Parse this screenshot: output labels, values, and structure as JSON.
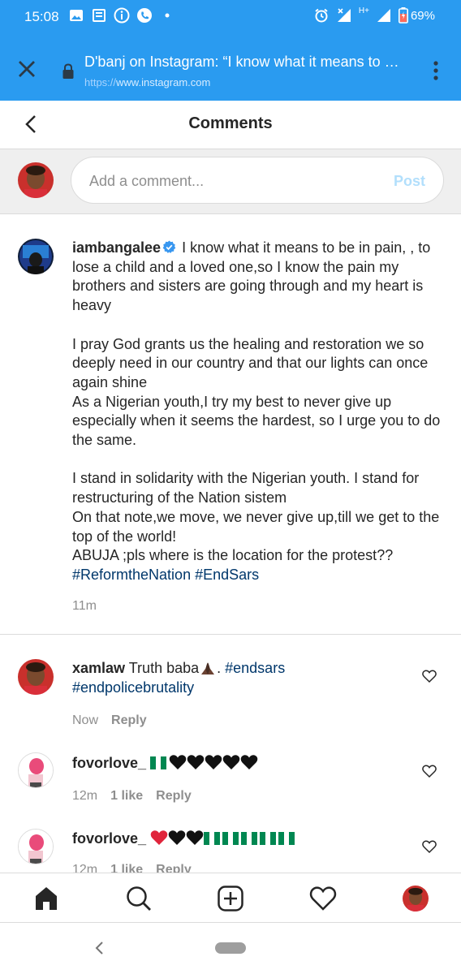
{
  "status_bar": {
    "time": "15:08",
    "battery": "69%",
    "network_label": "H+",
    "colors": {
      "background": "#2a9bf0"
    }
  },
  "browser": {
    "page_title": "D'banj on Instagram: “I know what it means to …",
    "url_protocol": "https://",
    "url_host": "www.instagram.com"
  },
  "header": {
    "title": "Comments"
  },
  "add_comment": {
    "placeholder": "Add a comment...",
    "post_label": "Post"
  },
  "caption": {
    "username": "iambangalee",
    "line1": "I know what it means to be in pain, , to lose a child and a loved one,so I know the pain my brothers and sisters are going through and my heart is heavy",
    "p2a": "I pray God grants us the healing and restoration we so deeply need in our country and that our lights can once again shine",
    "p2b": "As a Nigerian youth,I try my best to never give up especially when it seems the hardest, so I urge you to do the same.",
    "p3a": "I stand in solidarity with the Nigerian youth. I stand for restructuring of the Nation sistem",
    "p3b": "On that note,we move, we never give up,till we get to the top of the world!",
    "p3c": "ABUJA ;pls where is the location for the protest??",
    "hashtag1": "#ReformtheNation",
    "hashtag2": "#EndSars",
    "time": "11m"
  },
  "comments": [
    {
      "username": "xamlaw",
      "text": "Truth baba",
      "emoji": "praying-hands",
      "after_emoji": ". ",
      "hashtag1": "#endsars",
      "hashtag2": "#endpolicebrutality",
      "time": "Now",
      "reply": "Reply"
    },
    {
      "username": "fovorlove_",
      "emoji": "nigeria-flag, 5 black hearts",
      "time": "12m",
      "likes": "1 like",
      "reply": "Reply"
    },
    {
      "username": "fovorlove_",
      "emoji": "red heart, 2 black hearts, 5 nigeria flags",
      "time": "12m",
      "likes": "1 like",
      "reply": "Reply"
    }
  ],
  "nav": {
    "items": [
      "home-icon",
      "search-icon",
      "new-post-icon",
      "activity-heart-icon",
      "profile-avatar"
    ]
  }
}
